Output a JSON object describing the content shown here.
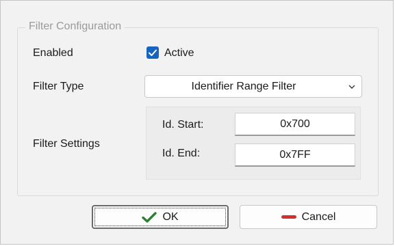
{
  "group": {
    "title": "Filter Configuration"
  },
  "enabled": {
    "label": "Enabled",
    "checkbox_label": "Active",
    "checked": true
  },
  "filter_type": {
    "label": "Filter Type",
    "selected": "Identifier Range Filter"
  },
  "filter_settings": {
    "label": "Filter Settings",
    "id_start_label": "Id. Start:",
    "id_start_value": "0x700",
    "id_end_label": "Id. End:",
    "id_end_value": "0x7FF"
  },
  "buttons": {
    "ok_label": "OK",
    "cancel_label": "Cancel"
  },
  "colors": {
    "accent": "#1565c0",
    "ok_check": "#2e7d32",
    "cancel_icon": "#d32f2f"
  },
  "icons": {
    "checkbox": "checkmark-icon",
    "combo": "chevron-down-icon",
    "ok": "check-icon",
    "cancel": "minus-icon"
  }
}
